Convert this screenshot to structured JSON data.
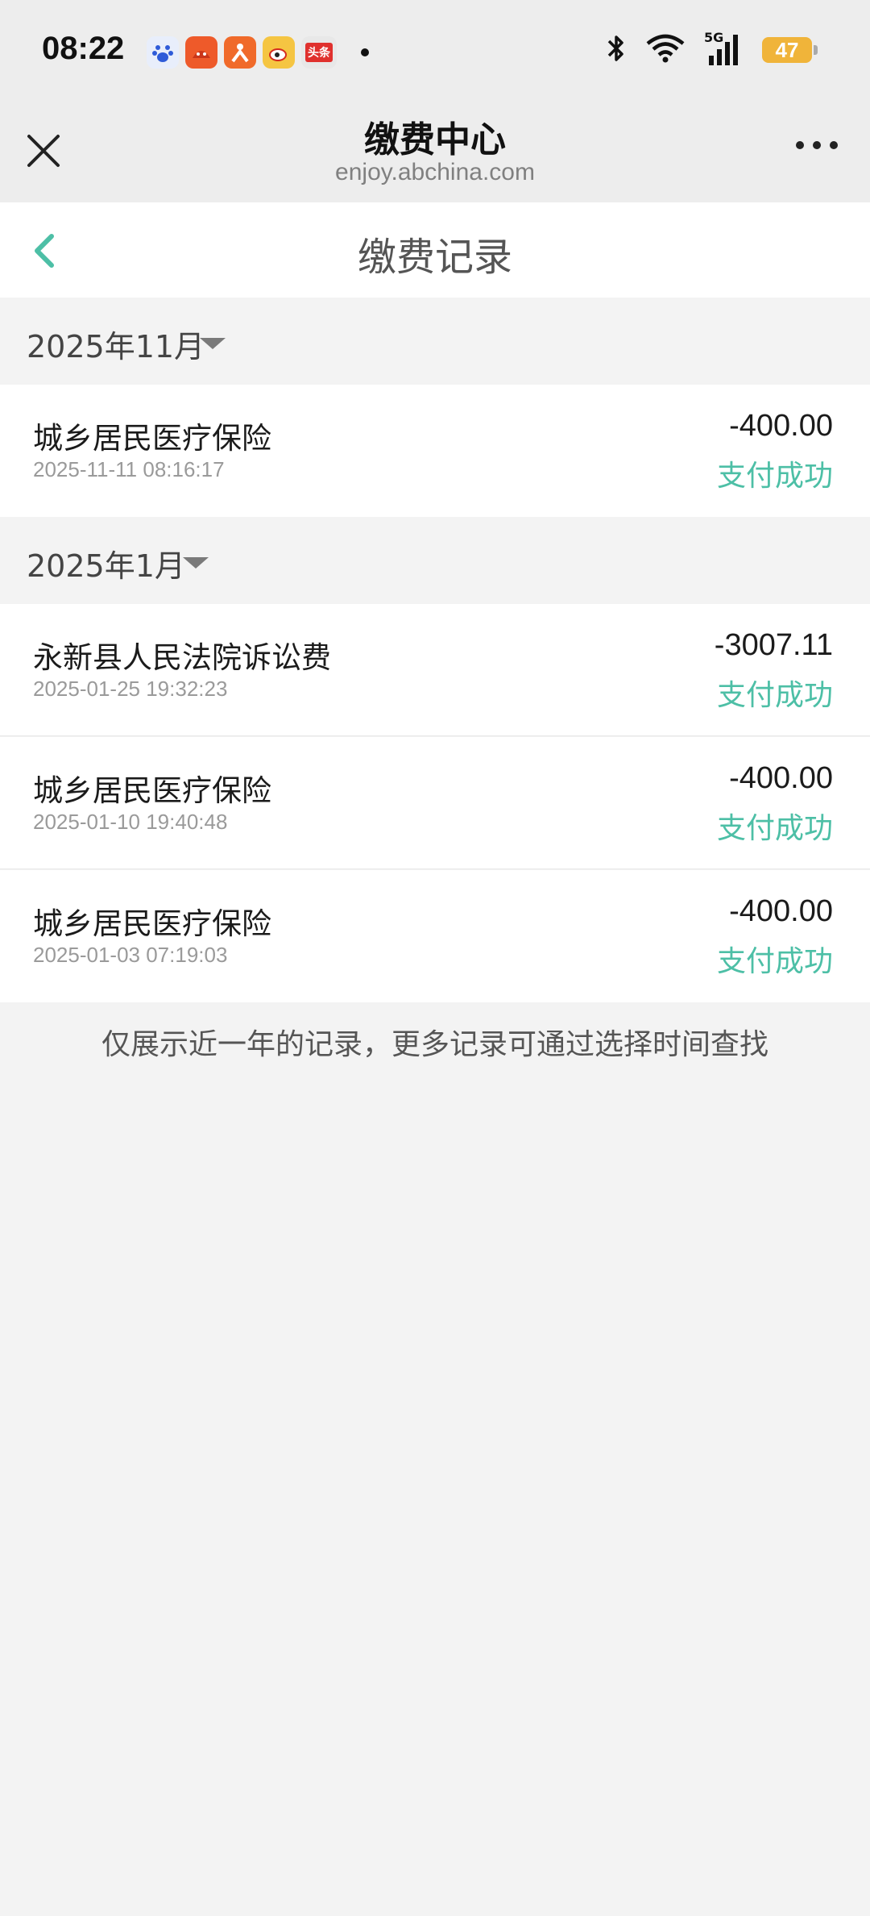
{
  "status_bar": {
    "time": "08:22",
    "app_icons": [
      "baidu-icon",
      "taobao-icon",
      "meituan-icon",
      "weibo-icon",
      "toutiao-icon"
    ],
    "toutiao_label": "头条",
    "network": "5G",
    "battery": "47"
  },
  "nav": {
    "title": "缴费中心",
    "subtitle": "enjoy.abchina.com"
  },
  "page": {
    "title": "缴费记录"
  },
  "months": [
    {
      "label": "2025年11月",
      "records": [
        {
          "name": "城乡居民医疗保险",
          "time": "2025-11-11 08:16:17",
          "amount": "-400.00",
          "status": "支付成功"
        }
      ]
    },
    {
      "label": "2025年1月",
      "records": [
        {
          "name": "永新县人民法院诉讼费",
          "time": "2025-01-25 19:32:23",
          "amount": "-3007.11",
          "status": "支付成功"
        },
        {
          "name": "城乡居民医疗保险",
          "time": "2025-01-10 19:40:48",
          "amount": "-400.00",
          "status": "支付成功"
        },
        {
          "name": "城乡居民医疗保险",
          "time": "2025-01-03 07:19:03",
          "amount": "-400.00",
          "status": "支付成功"
        }
      ]
    }
  ],
  "footer_note": "仅展示近一年的记录，更多记录可通过选择时间查找",
  "colors": {
    "accent": "#4dbfa6",
    "background": "#f3f3f3",
    "battery": "#f0b43a"
  }
}
